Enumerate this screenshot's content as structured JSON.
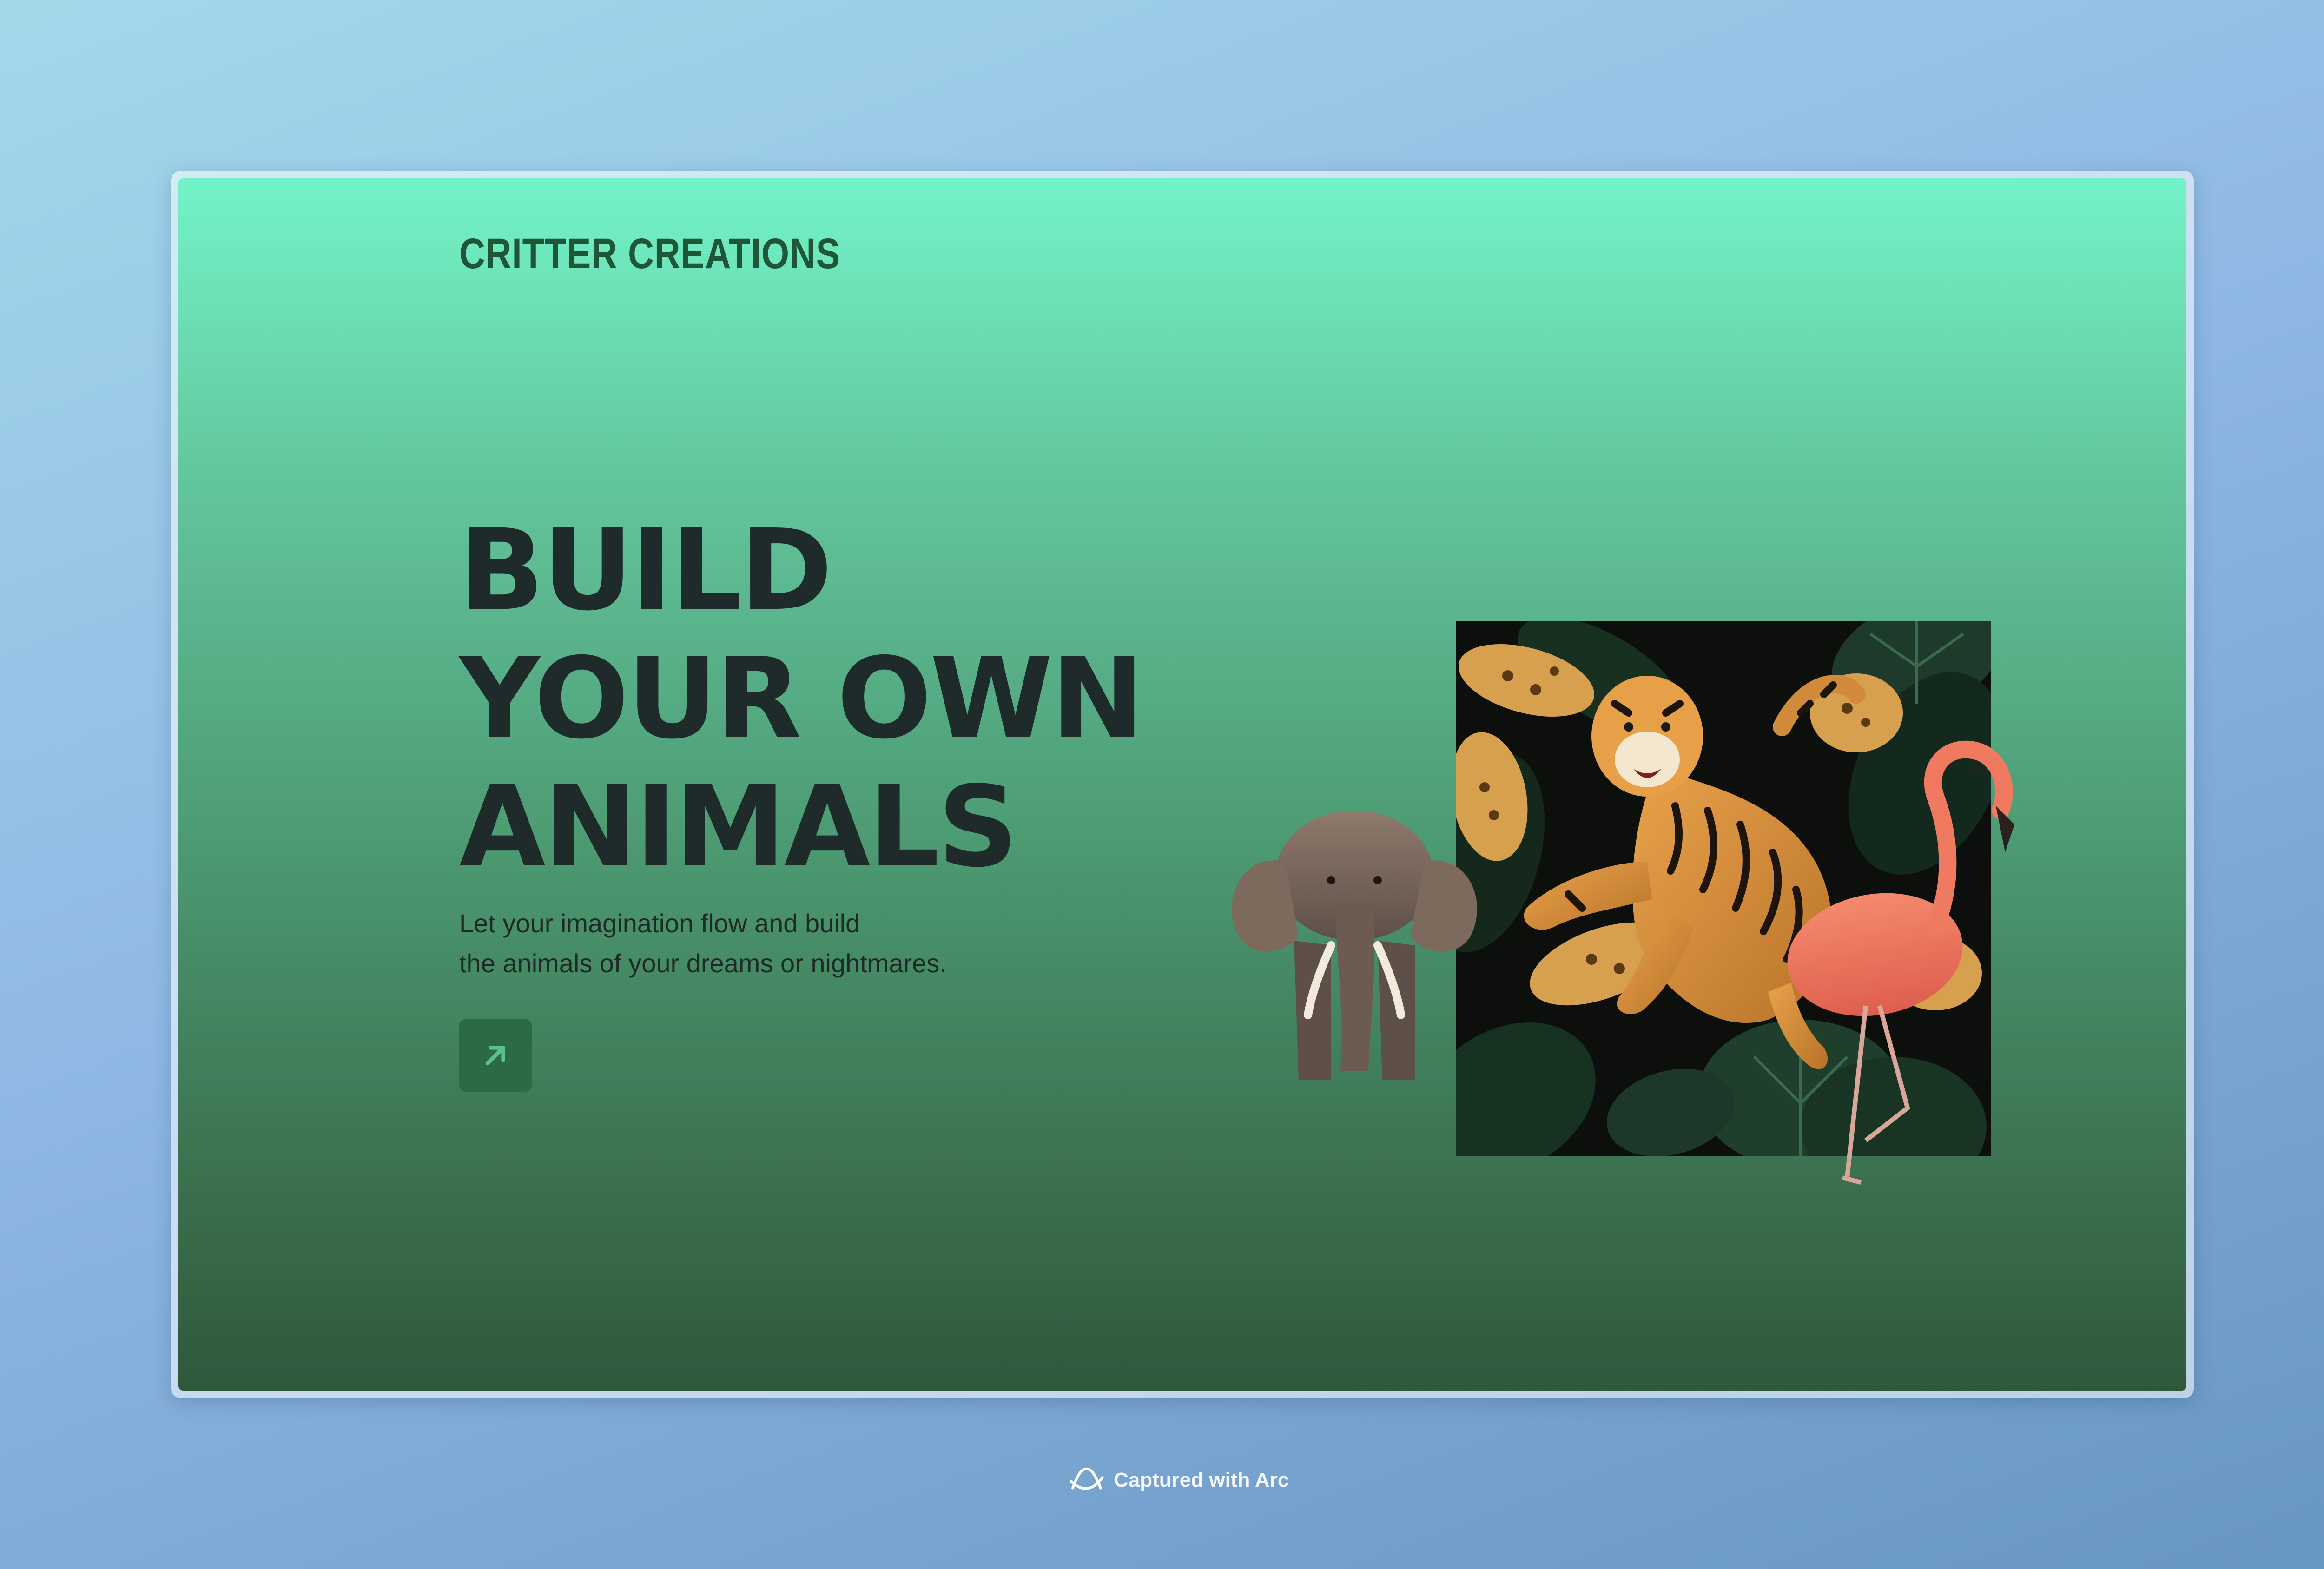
{
  "site": {
    "brand": "CRITTER CREATIONS"
  },
  "hero": {
    "headline_lines": [
      "BUILD",
      "YOUR OWN",
      "ANIMALS"
    ],
    "subtitle_lines": [
      "Let your imagination flow and build",
      "the animals of your dreams or nightmares."
    ],
    "cta_icon": "arrow-up-right-icon"
  },
  "artwork": {
    "subjects": [
      "elephant",
      "tiger",
      "flamingo",
      "jungle-leaf-pattern",
      "leopards"
    ]
  },
  "footer": {
    "text": "Captured with Arc",
    "icon": "arc-logo-icon"
  },
  "colors": {
    "gradient_top": "#73f3c8",
    "gradient_bottom": "#2f583b",
    "brand_text": "#1f5638",
    "headline_text": "#1f2b2b",
    "button_bg": "#2c6a45",
    "button_icon": "#5fbf8a"
  }
}
